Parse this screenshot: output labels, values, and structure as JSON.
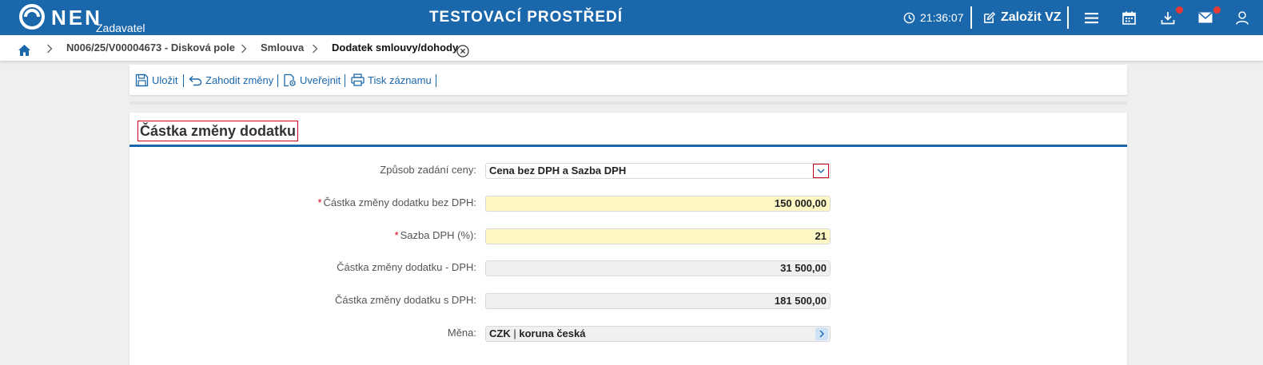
{
  "header": {
    "logo_text": "NEN",
    "logo_sub": "Zadavatel",
    "env_title": "TESTOVACÍ PROSTŘEDÍ",
    "time": "21:36:07",
    "new_vz_label": "Založit VZ"
  },
  "breadcrumb": {
    "items": [
      "N006/25/V00004673 - Disková pole",
      "Smlouva",
      "Dodatek smlouvy/dohody"
    ]
  },
  "toolbar": {
    "save_label": "Uložit",
    "discard_label": "Zahodit změny",
    "publish_label": "Uveřejnit",
    "print_label": "Tisk záznamu"
  },
  "section": {
    "title": "Částka změny dodatku"
  },
  "form": {
    "price_method": {
      "label": "Způsob zadání ceny:",
      "value": "Cena bez DPH a Sazba DPH"
    },
    "amount_without_vat": {
      "label": "Částka změny dodatku bez DPH:",
      "value": "150 000,00",
      "required_mark": "*"
    },
    "vat_rate": {
      "label": "Sazba DPH (%):",
      "value": "21",
      "required_mark": "*"
    },
    "vat_amount": {
      "label": "Částka změny dodatku - DPH:",
      "value": "31 500,00"
    },
    "amount_with_vat": {
      "label": "Částka změny dodatku s DPH:",
      "value": "181 500,00"
    },
    "currency": {
      "label": "Měna:",
      "code": "CZK",
      "separator": "|",
      "name": "koruna česká"
    }
  },
  "colors": {
    "brand": "#1a67ac",
    "required_bg": "#fff8c5",
    "highlight_border": "#d0021b",
    "notification_badge": "#e53935"
  }
}
